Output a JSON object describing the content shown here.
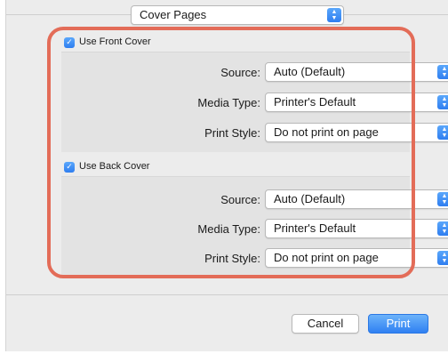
{
  "pane_selector": {
    "value": "Cover Pages"
  },
  "front_cover": {
    "checkbox_label": "Use Front Cover",
    "checked": true,
    "rows": [
      {
        "label": "Source:",
        "value": "Auto (Default)"
      },
      {
        "label": "Media Type:",
        "value": "Printer's Default"
      },
      {
        "label": "Print Style:",
        "value": "Do not print on page"
      }
    ]
  },
  "back_cover": {
    "checkbox_label": "Use Back Cover",
    "checked": true,
    "rows": [
      {
        "label": "Source:",
        "value": "Auto (Default)"
      },
      {
        "label": "Media Type:",
        "value": "Printer's Default"
      },
      {
        "label": "Print Style:",
        "value": "Do not print on page"
      }
    ]
  },
  "buttons": {
    "cancel": "Cancel",
    "print": "Print"
  },
  "colors": {
    "accent": "#3b8ef5",
    "highlight_outline": "#e36c58",
    "panel_bg": "#ececec"
  }
}
